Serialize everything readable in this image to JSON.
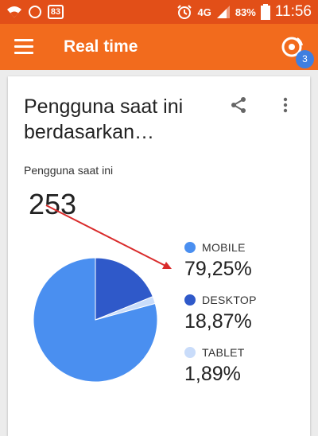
{
  "status_bar": {
    "notification_badge": "83",
    "network": "4G",
    "battery": "83%",
    "time": "11:56",
    "icons": [
      "wifi-icon",
      "circle-icon",
      "badge-icon",
      "alarm-icon",
      "signal-icon",
      "battery-icon"
    ]
  },
  "toolbar": {
    "title": "Real time",
    "realtime_count": "3",
    "icons": [
      "menu-icon",
      "realtime-icon"
    ]
  },
  "card": {
    "title": "Pengguna saat ini berdasarkan…",
    "current_users_label": "Pengguna saat ini",
    "current_users_count": "253",
    "icons": [
      "share-icon",
      "more-vert-icon"
    ]
  },
  "chart_data": {
    "type": "pie",
    "categories": [
      "MOBILE",
      "DESKTOP",
      "TABLET"
    ],
    "values": [
      79.25,
      18.87,
      1.89
    ],
    "labels": [
      "79,25%",
      "18,87%",
      "1,89%"
    ],
    "colors": [
      "#4a8ff0",
      "#2f59c9",
      "#c9dcfa"
    ],
    "legend_position": "right"
  },
  "colors": {
    "status_bar": "#e24f18",
    "toolbar": "#f26b1d",
    "accent_blue": "#3f7fe0",
    "annotation_arrow": "#d92b2b"
  }
}
